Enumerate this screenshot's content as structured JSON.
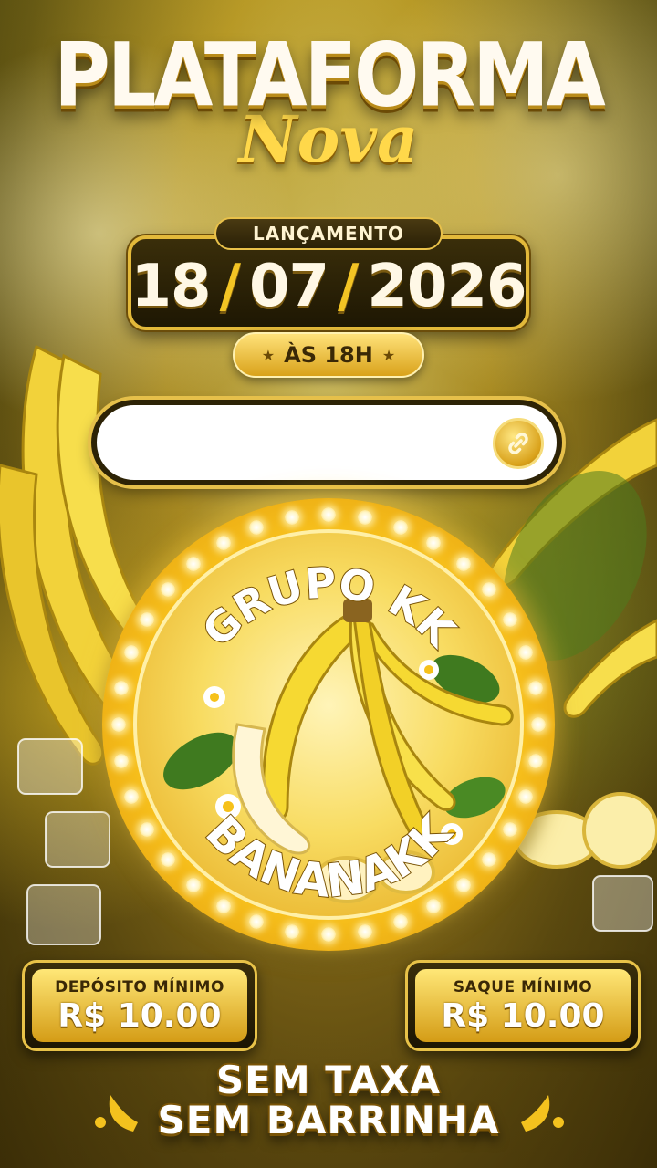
{
  "header": {
    "title": "PLATAFORMA",
    "subtitle": "Nova"
  },
  "launch": {
    "label": "LANÇAMENTO",
    "day": "18",
    "month": "07",
    "year": "2026",
    "separator": "/",
    "time": "ÀS 18H"
  },
  "link_field": {
    "value": "",
    "icon": "link-icon"
  },
  "medal": {
    "top_text": "GRUPO KK",
    "bottom_text": "BANANAKK"
  },
  "deposit": {
    "label": "DEPÓSITO MÍNIMO",
    "value": "R$ 10.00"
  },
  "withdraw": {
    "label": "SAQUE MÍNIMO",
    "value": "R$ 10.00"
  },
  "footer": {
    "line1": "SEM TAXA",
    "line2": "SEM BARRINHA"
  },
  "colors": {
    "gold": "#e8c248",
    "dark": "#2d2306",
    "banana": "#f6d932"
  }
}
